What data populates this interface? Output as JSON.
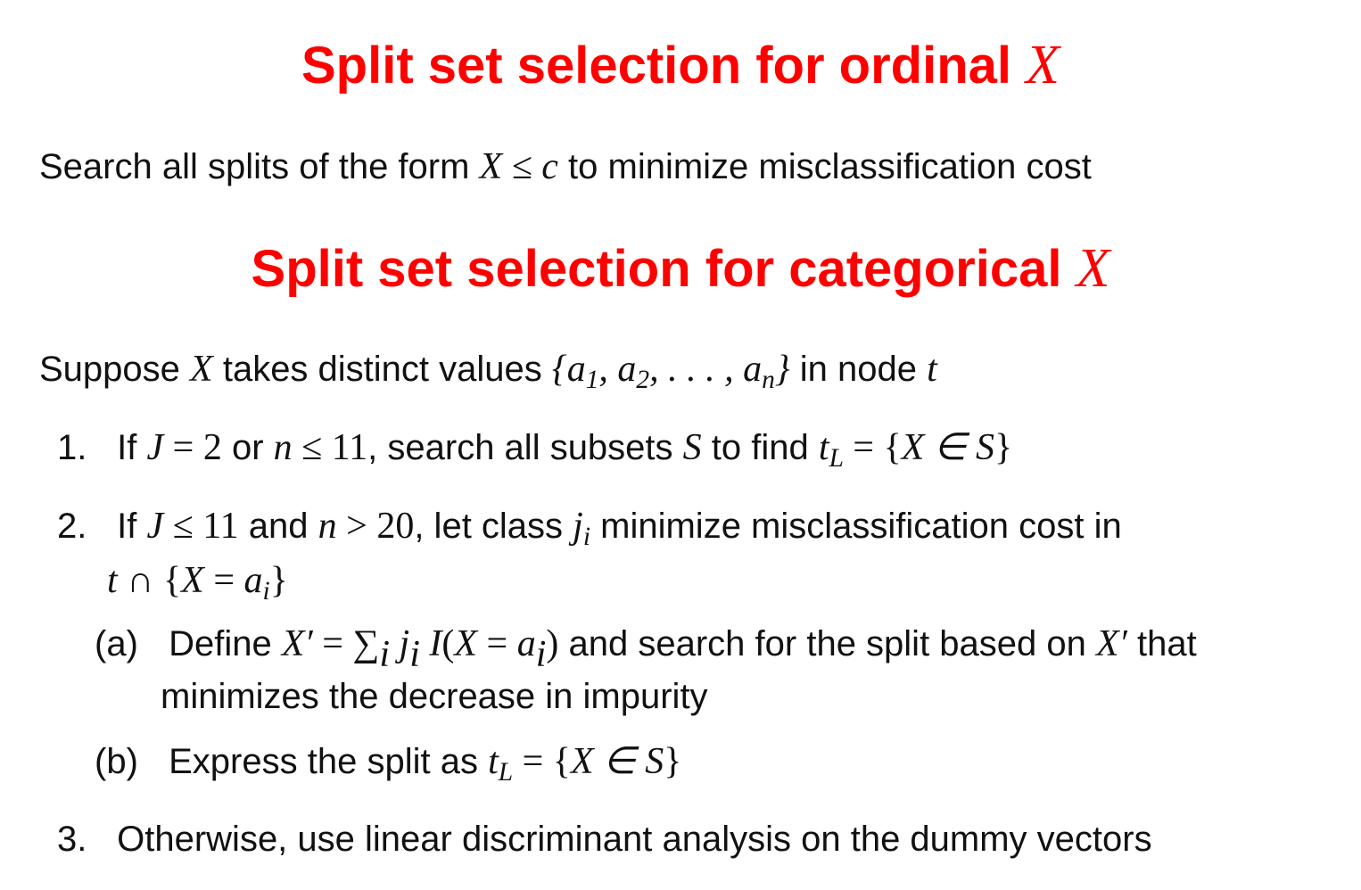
{
  "colors": {
    "title": "#ff0000",
    "text": "#111111",
    "background": "#ffffff"
  },
  "ordinal": {
    "title_text": "Split set selection for ordinal",
    "title_var": "X",
    "line_prefix": "Search all splits of the form",
    "line_math": "X ≤ c",
    "line_suffix": "to minimize misclassification cost"
  },
  "categorical": {
    "title_text": "Split set selection for categorical",
    "title_var": "X",
    "intro": {
      "t1": "Suppose",
      "m1": "X",
      "t2": "takes distinct values",
      "m2_open": "{a",
      "m2_s1": "1",
      "m2_mid": ", a",
      "m2_s2": "2",
      "m2_rest": ", . . . , a",
      "m2_sn": "n",
      "m2_close": "}",
      "t3": "in node",
      "m3": "t"
    },
    "items": [
      {
        "number": "1.",
        "t1": "If",
        "m1": "J",
        "m1r": " = 2",
        "t2": "or",
        "m2": "n",
        "m2r": " ≤ 11",
        "t3": ", search all subsets",
        "m3": "S",
        "t4": "to find",
        "m4": "t",
        "m4sub": "L",
        "m4r": " = {",
        "m4v": "X ∈ S",
        "m4c": "}"
      },
      {
        "number": "2.",
        "t1": "If",
        "m1": "J",
        "m1r": " ≤ 11",
        "t2": "and",
        "m2": "n",
        "m2r": " > 20",
        "t3": ", let class",
        "m3": "j",
        "m3sub": "i",
        "t4": "minimize misclassification cost in",
        "l2_m1": "t",
        "l2_r1": " ∩ {",
        "l2_m2": "X",
        "l2_r2": " = ",
        "l2_m3": "a",
        "l2_sub": "i",
        "l2_c": "}",
        "subitems": [
          {
            "label": "(a)",
            "t1": "Define",
            "m1": "X′",
            "m1r": " = ∑",
            "m1sub": "i",
            "m2": " j",
            "m2sub": "i",
            "m3": " I",
            "m3r": "(",
            "m4": "X",
            "m4r": " = ",
            "m5": "a",
            "m5sub": "i",
            "m5r": ")",
            "t2": "and search for the split based on",
            "m6": "X′",
            "t3": "that",
            "line2": "minimizes the decrease in impurity"
          },
          {
            "label": "(b)",
            "t1": "Express the split as",
            "m1": "t",
            "m1sub": "L",
            "m1r": " = {",
            "m2": "X ∈ S",
            "m2c": "}"
          }
        ]
      },
      {
        "number": "3.",
        "text": "Otherwise, use linear discriminant analysis on the dummy vectors"
      }
    ]
  }
}
